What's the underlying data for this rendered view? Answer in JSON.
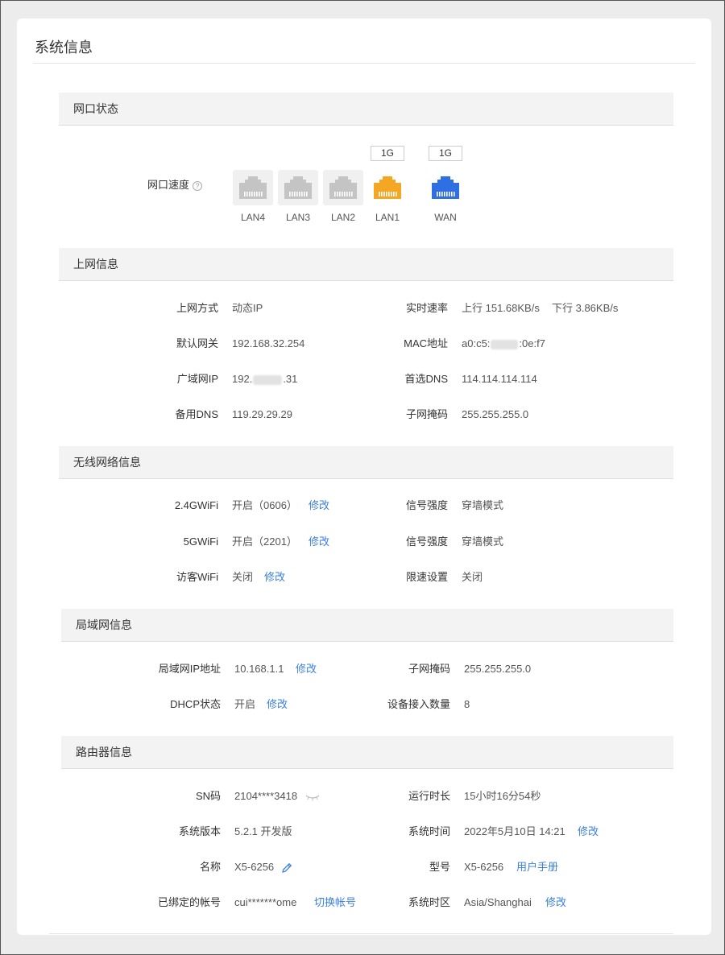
{
  "page": {
    "title": "系统信息"
  },
  "port_status": {
    "title": "网口状态",
    "speed_label": "网口速度",
    "help_icon": "?",
    "ports": [
      {
        "name": "LAN4",
        "speed": "",
        "state": "inactive",
        "color": "#c4c4c4"
      },
      {
        "name": "LAN3",
        "speed": "",
        "state": "inactive",
        "color": "#c4c4c4"
      },
      {
        "name": "LAN2",
        "speed": "",
        "state": "inactive",
        "color": "#c4c4c4"
      },
      {
        "name": "LAN1",
        "speed": "1G",
        "state": "active",
        "color": "#f5a623"
      },
      {
        "name": "WAN",
        "speed": "1G",
        "state": "active",
        "color": "#2f6fe4"
      }
    ]
  },
  "internet": {
    "title": "上网信息",
    "mode_label": "上网方式",
    "mode_value": "动态IP",
    "speed_label": "实时速率",
    "speed_up": "上行 151.68KB/s",
    "speed_down": "下行 3.86KB/s",
    "gateway_label": "默认网关",
    "gateway_value": "192.168.32.254",
    "mac_label": "MAC地址",
    "mac_prefix": "a0:c5:",
    "mac_suffix": ":0e:f7",
    "wan_ip_label": "广域网IP",
    "wan_ip_prefix": "192.",
    "wan_ip_suffix": ".31",
    "dns1_label": "首选DNS",
    "dns1_value": "114.114.114.114",
    "dns2_label": "备用DNS",
    "dns2_value": "119.29.29.29",
    "mask_label": "子网掩码",
    "mask_value": "255.255.255.0"
  },
  "wireless": {
    "title": "无线网络信息",
    "wifi24_label": "2.4GWiFi",
    "wifi24_value": "开启（0606）",
    "wifi24_edit": "修改",
    "signal1_label": "信号强度",
    "signal1_value": "穿墙模式",
    "wifi5_label": "5GWiFi",
    "wifi5_value": "开启（2201）",
    "wifi5_edit": "修改",
    "signal2_label": "信号强度",
    "signal2_value": "穿墙模式",
    "guest_label": "访客WiFi",
    "guest_value": "关闭",
    "guest_edit": "修改",
    "limit_label": "限速设置",
    "limit_value": "关闭"
  },
  "lan": {
    "title": "局域网信息",
    "ip_label": "局域网IP地址",
    "ip_value": "10.168.1.1",
    "ip_edit": "修改",
    "mask_label": "子网掩码",
    "mask_value": "255.255.255.0",
    "dhcp_label": "DHCP状态",
    "dhcp_value": "开启",
    "dhcp_edit": "修改",
    "devices_label": "设备接入数量",
    "devices_value": "8"
  },
  "router": {
    "title": "路由器信息",
    "sn_label": "SN码",
    "sn_value": "2104****3418",
    "uptime_label": "运行时长",
    "uptime_value": "15小时16分54秒",
    "version_label": "系统版本",
    "version_value": "5.2.1 开发版",
    "time_label": "系统时间",
    "time_value": "2022年5月10日 14:21",
    "time_edit": "修改",
    "name_label": "名称",
    "name_value": "X5-6256",
    "model_label": "型号",
    "model_value": "X5-6256",
    "manual_link": "用户手册",
    "account_label": "已绑定的帐号",
    "account_value": "cui*******ome",
    "switch_account": "切换帐号",
    "tz_label": "系统时区",
    "tz_value": "Asia/Shanghai",
    "tz_edit": "修改"
  }
}
